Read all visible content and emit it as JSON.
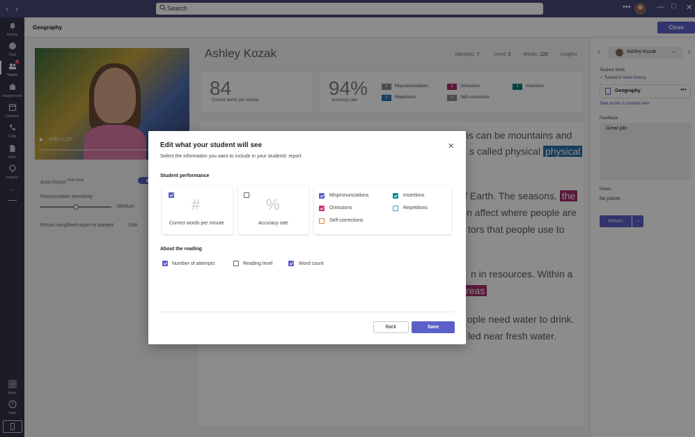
{
  "topbar": {
    "search_placeholder": "Search",
    "back_icon": "chevron-left-icon",
    "forward_icon": "chevron-right-icon",
    "more_icon": "more-icon",
    "minimize_icon": "minimize-icon",
    "maximize_icon": "maximize-icon",
    "close_icon": "close-icon"
  },
  "rail": {
    "items": [
      {
        "label": "Activity",
        "icon": "bell-icon"
      },
      {
        "label": "Chat",
        "icon": "chat-icon"
      },
      {
        "label": "Teams",
        "icon": "teams-icon",
        "badge": "3"
      },
      {
        "label": "Assignments",
        "icon": "assignments-icon"
      },
      {
        "label": "Calendar",
        "icon": "calendar-icon"
      },
      {
        "label": "Calls",
        "icon": "calls-icon"
      },
      {
        "label": "Files",
        "icon": "files-icon"
      },
      {
        "label": "Insights",
        "icon": "insights-icon"
      }
    ],
    "more": "...",
    "apps": "Apps",
    "help": "Help"
  },
  "header": {
    "title": "Geography",
    "close_label": "Close"
  },
  "video": {
    "time": "0:00 / 1:27"
  },
  "student": {
    "name": "Ashley Kozak",
    "attempts_label": "Attempts:",
    "attempts": "7",
    "level_label": "Level:",
    "level": "2",
    "words_label": "Words:",
    "words": "129",
    "insights": "Insights"
  },
  "metrics": {
    "wpm": "84",
    "wpm_label": "Correct words per minute",
    "accuracy": "94%",
    "accuracy_label": "Accuracy rate",
    "mispronunciations": "Mispronunciations",
    "mispronunciations_count": "0",
    "omissions": "Omissions",
    "omissions_count": "5",
    "insertions": "Insertions",
    "insertions_count": "3",
    "repetitions": "Repetitions",
    "repetitions_count": "5",
    "self_corrections": "Self-corrections",
    "self_corrections_count": "0"
  },
  "settings": {
    "auto_detect": "Auto-Detect",
    "preview": "PREVIEW",
    "pron_sensitivity": "Pronunciation sensitivity",
    "sensitivity_value": "Medium",
    "sensitivity_level": 0.5,
    "return_report": "Return simplified report to student",
    "edit": "Edit"
  },
  "reading": {
    "line1": "ms can be mountains and",
    "line2a": "s called physical ",
    "line2b": "physical",
    "line3a": "f Earth. The seasons, ",
    "line3b": "the",
    "line4": "n affect where people are",
    "line5": "tors that people use to",
    "line6": "n in resources. Within a",
    "line7": "reas",
    "line8": "ople need water to drink.",
    "line9": "led near fresh water."
  },
  "right_panel": {
    "student_name": "Ashley Kozak",
    "student_work": "Student Work",
    "turned_in": "Turned in",
    "view_history": "View History",
    "file_name": "Geography",
    "take_action": "Take action in student view",
    "feedback_label": "Feedback",
    "feedback_text": "Great job!",
    "points_label": "Points",
    "points_value": "No points",
    "return_label": "Return"
  },
  "dialog": {
    "title": "Edit what your student will see",
    "subtitle": "Select the information you want to include in your students' report.",
    "performance_heading": "Student performance",
    "wpm_option": "Correct words per minute",
    "wpm_checked": true,
    "accuracy_option": "Accuracy rate",
    "accuracy_checked": false,
    "mispronunciations": "Mispronunciations",
    "insertions": "Insertions",
    "omissions": "Omissions",
    "repetitions": "Repetitions",
    "self_corrections": "Self-corrections",
    "about_heading": "About the reading",
    "attempts_option": "Number of attempts",
    "reading_level_option": "Reading level",
    "word_count_option": "Word count",
    "back_label": "Back",
    "save_label": "Save",
    "hash_symbol": "#",
    "percent_symbol": "%"
  }
}
